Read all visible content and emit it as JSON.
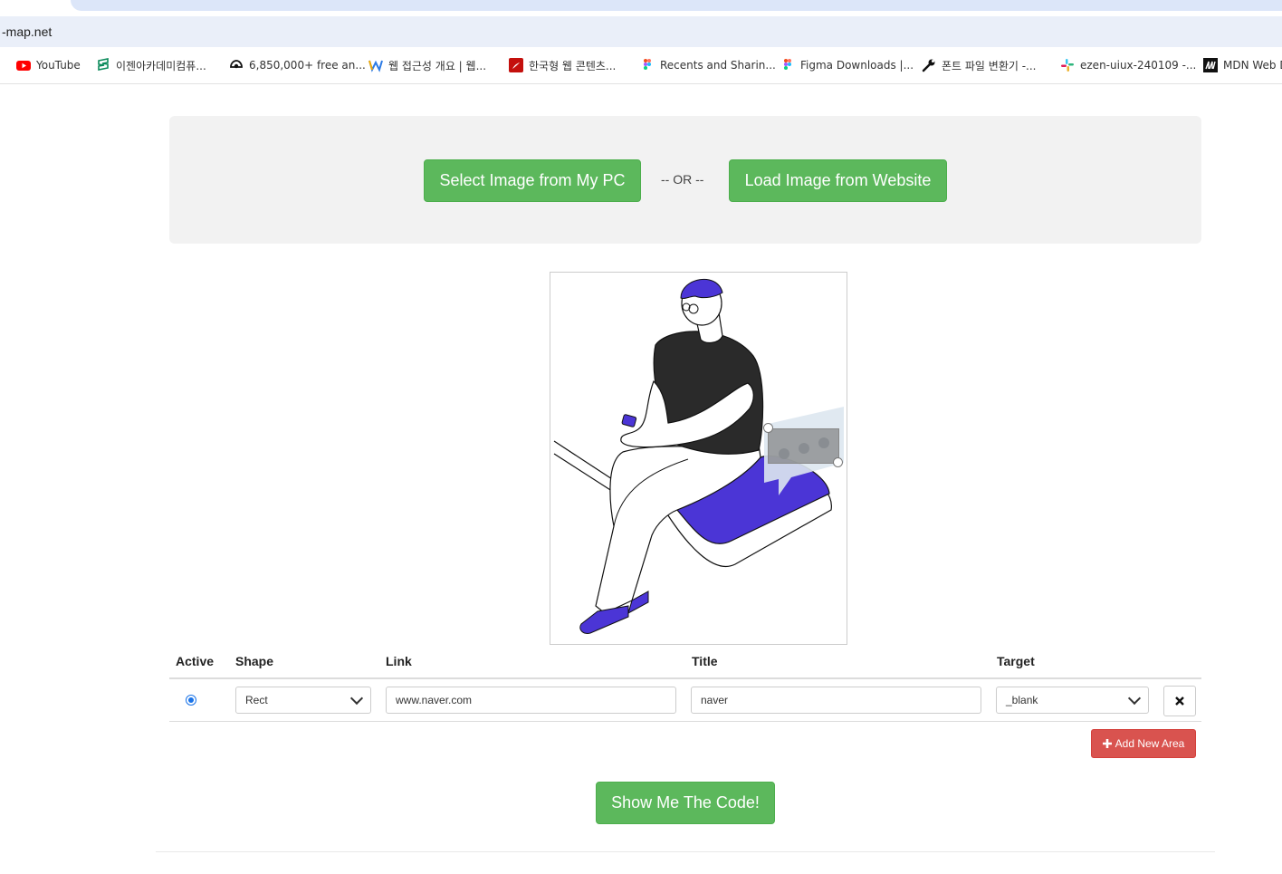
{
  "browser": {
    "url_fragment": "-map.net",
    "bookmarks": [
      {
        "label": "YouTube",
        "icon": "youtube-icon"
      },
      {
        "label": "이젠아카데미컴퓨...",
        "icon": "ezen-icon"
      },
      {
        "label": "6,850,000+ free an...",
        "icon": "freepik-icon"
      },
      {
        "label": "웹 접근성 개요 | 웹...",
        "icon": "w-icon"
      },
      {
        "label": "한국형 웹 콘텐츠...",
        "icon": "pdf-icon"
      },
      {
        "label": "Recents and Sharin...",
        "icon": "figma-icon"
      },
      {
        "label": "Figma Downloads |...",
        "icon": "figma-icon"
      },
      {
        "label": "폰트 파일 변환기 -...",
        "icon": "wrench-icon"
      },
      {
        "label": "ezen-uiux-240109 -...",
        "icon": "slack-icon"
      },
      {
        "label": "MDN Web D",
        "icon": "mdn-icon"
      }
    ]
  },
  "loader": {
    "select_pc_label": "Select Image from My PC",
    "or_label": "-- OR --",
    "load_web_label": "Load Image from Website"
  },
  "table": {
    "headers": {
      "active": "Active",
      "shape": "Shape",
      "link": "Link",
      "title": "Title",
      "target": "Target"
    },
    "row": {
      "active": true,
      "shape": "Rect",
      "link": "www.naver.com",
      "title": "naver",
      "target": "_blank",
      "delete_icon": "close-icon"
    },
    "add_label": "Add New Area"
  },
  "code_button_label": "Show Me The Code!",
  "colors": {
    "green": "#5cb85c",
    "red": "#d9534f",
    "accent_purple": "#4b35d6",
    "radio_blue": "#1a73e8"
  }
}
